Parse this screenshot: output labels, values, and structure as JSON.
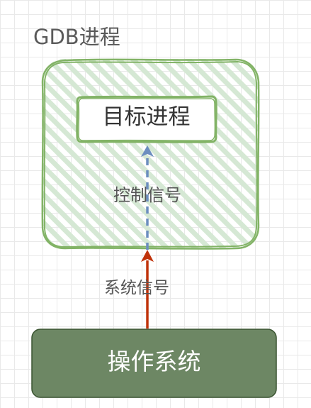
{
  "gdb_process": {
    "title": "GDB进程"
  },
  "target_process": {
    "label": "目标进程"
  },
  "control_signal": {
    "label": "控制信号"
  },
  "system_signal": {
    "label": "系统信号"
  },
  "operating_system": {
    "label": "操作系统"
  },
  "colors": {
    "container_stroke": "#82b366",
    "container_hatch": "#d5e8d4",
    "os_fill": "#6d8764",
    "os_stroke": "#3a5431",
    "control_arrow": "#6c8ebf",
    "system_arrow": "#c0320a"
  }
}
